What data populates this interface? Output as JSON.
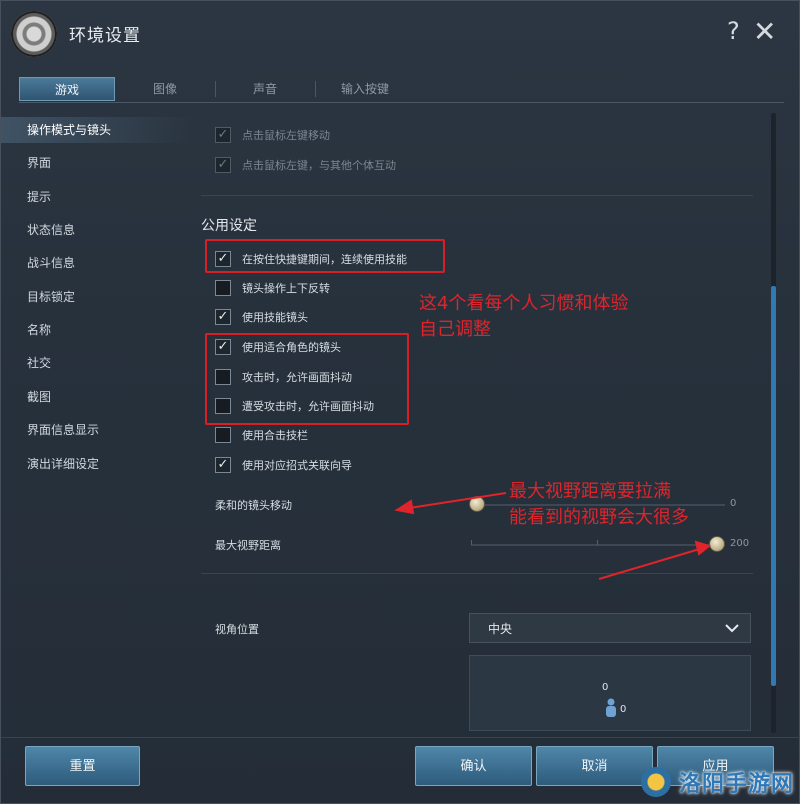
{
  "window": {
    "title": "环境设置"
  },
  "titlebar": {
    "help_glyph": "?",
    "close_glyph": "✕"
  },
  "tabs": [
    {
      "label": "游戏",
      "active": true
    },
    {
      "label": "图像",
      "active": false
    },
    {
      "label": "声音",
      "active": false
    },
    {
      "label": "输入按键",
      "active": false
    }
  ],
  "sidebar": {
    "items": [
      {
        "label": "操作模式与镜头",
        "active": true
      },
      {
        "label": "界面"
      },
      {
        "label": "提示"
      },
      {
        "label": "状态信息"
      },
      {
        "label": "战斗信息"
      },
      {
        "label": "目标锁定"
      },
      {
        "label": "名称"
      },
      {
        "label": "社交"
      },
      {
        "label": "截图"
      },
      {
        "label": "界面信息显示"
      },
      {
        "label": "演出详细设定"
      }
    ]
  },
  "content": {
    "top_options": [
      {
        "label": "点击鼠标左键移动",
        "checked": true,
        "disabled": true
      },
      {
        "label": "点击鼠标左键，与其他个体互动",
        "checked": true,
        "disabled": true
      }
    ],
    "section_title": "公用设定",
    "options": [
      {
        "label": "在按住快捷键期间，连续使用技能",
        "checked": true
      },
      {
        "label": "镜头操作上下反转",
        "checked": false
      },
      {
        "label": "使用技能镜头",
        "checked": true
      },
      {
        "label": "使用适合角色的镜头",
        "checked": true
      },
      {
        "label": "攻击时，允许画面抖动",
        "checked": false
      },
      {
        "label": "遭受攻击时，允许画面抖动",
        "checked": false
      },
      {
        "label": "使用合击技栏",
        "checked": false
      },
      {
        "label": "使用对应招式关联向导",
        "checked": true
      }
    ],
    "check_glyph": "✓",
    "sliders": [
      {
        "label": "柔和的镜头移动",
        "value": "0",
        "level": 0.0
      },
      {
        "label": "最大视野距离",
        "value": "200",
        "level": 1.0
      }
    ],
    "view_position": {
      "label": "视角位置",
      "selected": "中央",
      "preview_top": "0",
      "preview_right": "0"
    }
  },
  "annotations": {
    "note1_line1": "这4个看每个人习惯和体验",
    "note1_line2": "自己调整",
    "note2_line1": "最大视野距离要拉满",
    "note2_line2": "能看到的视野会大很多",
    "color": "#e0242b"
  },
  "footer": {
    "reset": "重置",
    "confirm": "确认",
    "cancel": "取消",
    "apply": "应用"
  },
  "watermark": {
    "text": "洛阳手游网"
  }
}
